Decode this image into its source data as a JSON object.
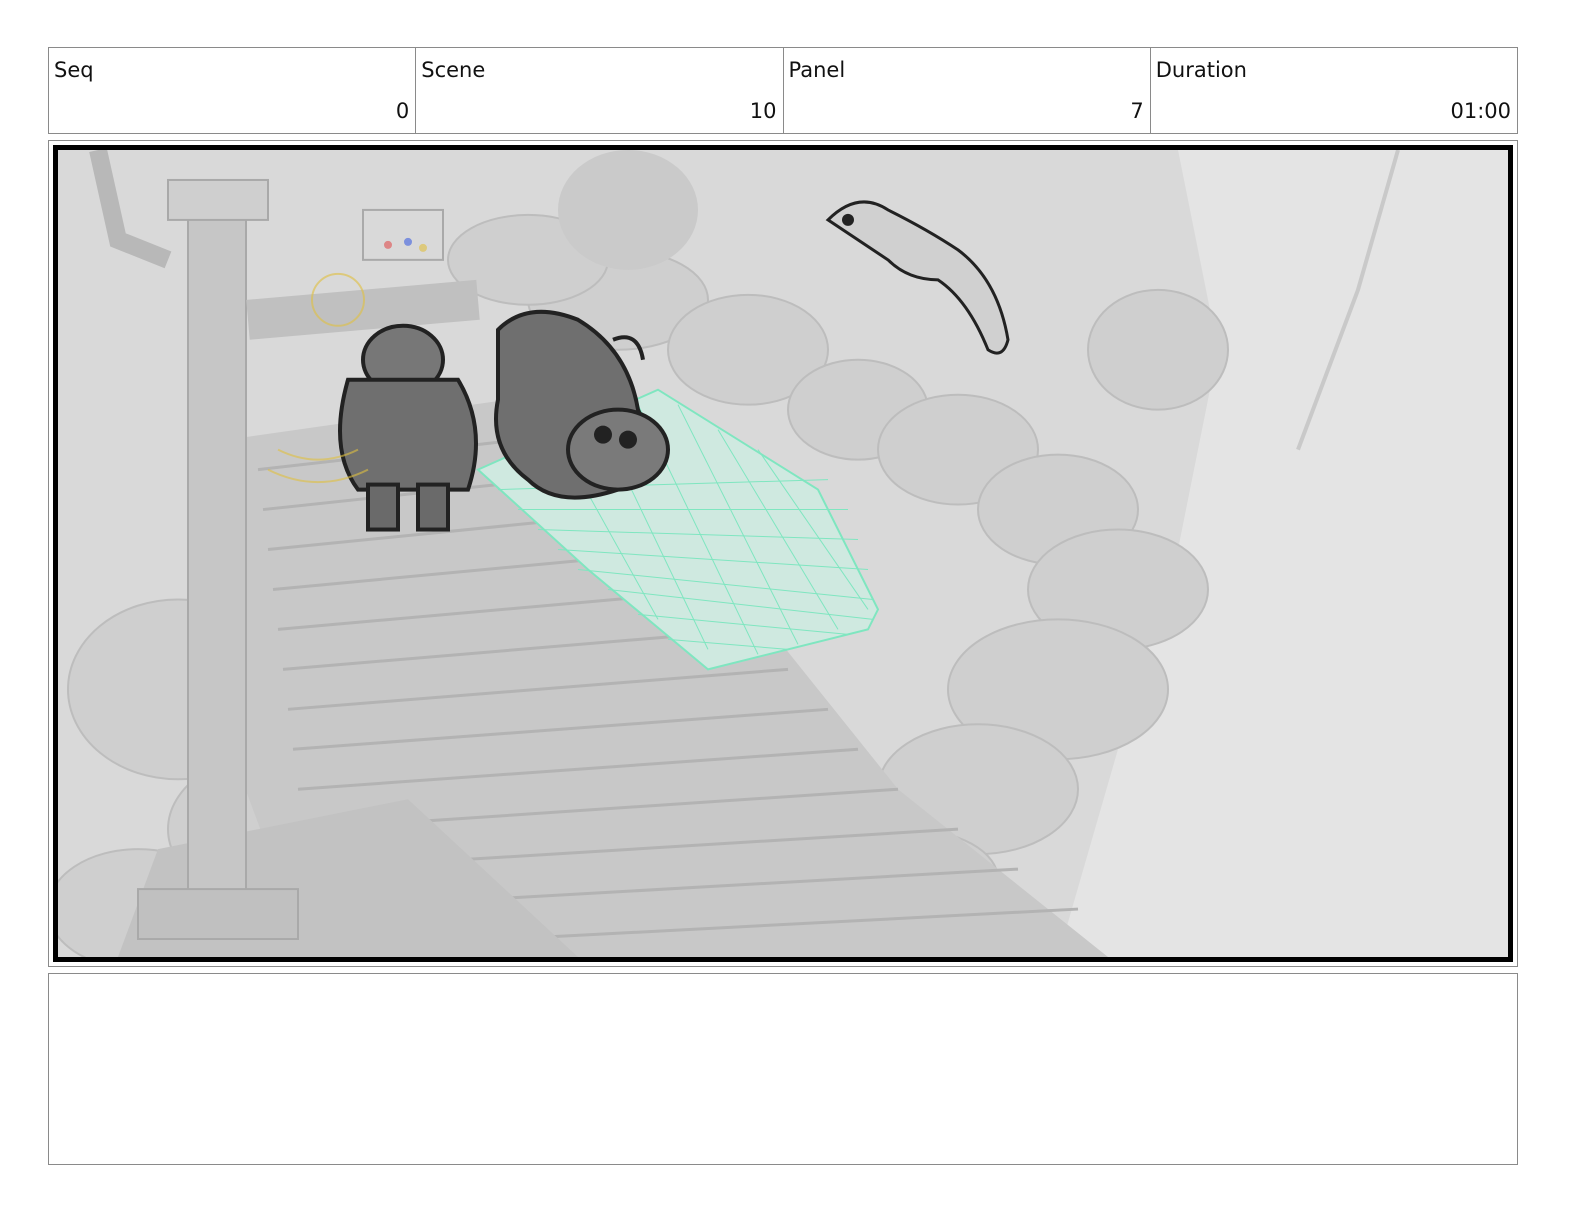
{
  "header": {
    "fields": [
      {
        "label": "Seq",
        "value": "0"
      },
      {
        "label": "Scene",
        "value": "10"
      },
      {
        "label": "Panel",
        "value": "7"
      },
      {
        "label": "Duration",
        "value": "01:00"
      }
    ]
  },
  "panel": {
    "image": "storyboard-frame",
    "colors": {
      "background": "#d8d8d8",
      "grid": "#7fe6c0",
      "sketch": "#222222"
    }
  },
  "notes": {
    "text": ""
  }
}
